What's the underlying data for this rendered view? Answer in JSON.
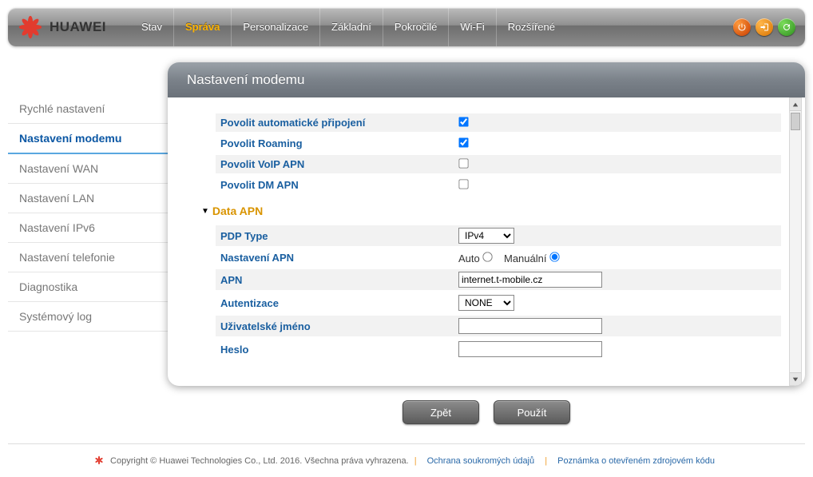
{
  "brand": "HUAWEI",
  "nav": {
    "items": [
      {
        "label": "Stav",
        "active": false
      },
      {
        "label": "Správa",
        "active": true
      },
      {
        "label": "Personalizace",
        "active": false
      },
      {
        "label": "Základní",
        "active": false
      },
      {
        "label": "Pokročilé",
        "active": false
      },
      {
        "label": "Wi-Fi",
        "active": false
      },
      {
        "label": "Rozšířené",
        "active": false
      }
    ]
  },
  "sidebar": {
    "items": [
      {
        "label": "Rychlé nastavení",
        "active": false
      },
      {
        "label": "Nastavení modemu",
        "active": true
      },
      {
        "label": "Nastavení WAN",
        "active": false
      },
      {
        "label": "Nastavení LAN",
        "active": false
      },
      {
        "label": "Nastavení IPv6",
        "active": false
      },
      {
        "label": "Nastavení telefonie",
        "active": false
      },
      {
        "label": "Diagnostika",
        "active": false
      },
      {
        "label": "Systémový log",
        "active": false
      }
    ]
  },
  "panel": {
    "title": "Nastavení modemu",
    "rows": {
      "auto_connect_label": "Povolit automatické připojení",
      "auto_connect_checked": true,
      "roaming_label": "Povolit Roaming",
      "roaming_checked": true,
      "voip_label": "Povolit VoIP APN",
      "voip_checked": false,
      "dm_label": "Povolit DM APN",
      "dm_checked": false
    },
    "section_title": "Data APN",
    "pdp": {
      "label": "PDP Type",
      "value": "IPv4"
    },
    "apn_setting": {
      "label": "Nastavení APN",
      "auto_label": "Auto",
      "manual_label": "Manuální",
      "selected": "manual"
    },
    "apn": {
      "label": "APN",
      "value": "internet.t-mobile.cz"
    },
    "auth": {
      "label": "Autentizace",
      "value": "NONE"
    },
    "user": {
      "label": "Uživatelské jméno",
      "value": ""
    },
    "pass": {
      "label": "Heslo",
      "value": ""
    }
  },
  "buttons": {
    "back": "Zpět",
    "apply": "Použít"
  },
  "footer": {
    "copyright": "Copyright © Huawei Technologies Co., Ltd. 2016. Všechna práva vyhrazena.",
    "privacy": "Ochrana soukromých údajů",
    "oss": "Poznámka o otevřeném zdrojovém kódu"
  }
}
